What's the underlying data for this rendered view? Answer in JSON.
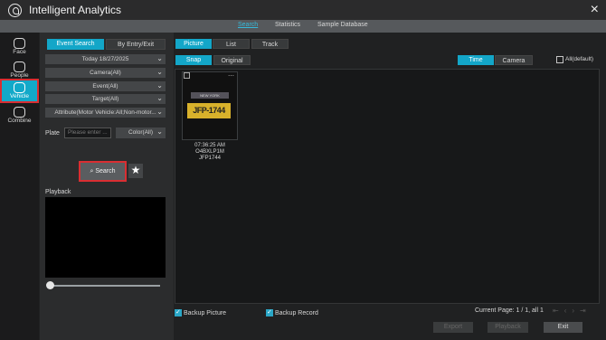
{
  "window": {
    "title": "Intelligent Analytics"
  },
  "topnav": {
    "items": [
      "Search",
      "Statistics",
      "Sample Database"
    ]
  },
  "sidebar": {
    "items": [
      {
        "label": "Face",
        "icon": "face-icon"
      },
      {
        "label": "People",
        "icon": "people-icon"
      },
      {
        "label": "Vehicle",
        "icon": "vehicle-icon"
      },
      {
        "label": "Combine",
        "icon": "combine-icon"
      }
    ]
  },
  "panel": {
    "tabs": [
      "Event Search",
      "By Entry/Exit"
    ],
    "date": "Today 18/27/2025",
    "camera": "Camera(All)",
    "event": "Event(All)",
    "target": "Target(All)",
    "attribute": "Attribute(Motor Vehicle:All;Non-motor...",
    "plate_label": "Plate",
    "plate_placeholder": "Please enter ...",
    "color": "Color(All)",
    "search_label": "Search",
    "playback_label": "Playback"
  },
  "main": {
    "view_tabs": [
      "Picture",
      "List",
      "Track"
    ],
    "snap_tabs": [
      "Snap",
      "Original"
    ],
    "sort_tabs": [
      "Time",
      "Camera"
    ],
    "all_default": "All(default)",
    "result": {
      "plate_text": "JFP-1744",
      "plate_top": "NEW YORK",
      "time": "07:36:25 AM",
      "camera": "O4BXLP1M",
      "plate": "JFP1744"
    },
    "backup_picture": "Backup Picture",
    "backup_record": "Backup Record",
    "pager": "Current Page: 1 / 1, all 1",
    "export": "Export",
    "playback": "Playback",
    "exit": "Exit"
  },
  "colors": {
    "accent": "#13a6c8",
    "highlight": "#d92e32"
  }
}
